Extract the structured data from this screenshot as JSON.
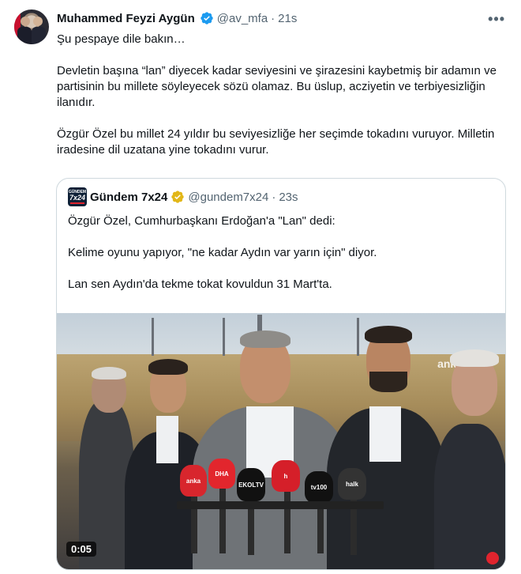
{
  "author": {
    "name": "Muhammed Feyzi Aygün",
    "handle": "@av_mfa",
    "separator": "·",
    "time": "21s",
    "more_label": "•••"
  },
  "tweet": {
    "lines": [
      "Şu pespaye dile bakın…",
      "",
      "Devletin başına “lan” diyecek kadar seviyesini ve şirazesini kaybetmiş bir adamın ve partisinin bu millete söyleyecek sözü olamaz. Bu üslup, acziyetin ve terbiyesizliğin ilanıdır.",
      "",
      "Özgür Özel bu millet 24 yıldır bu seviyesizliğe her seçimde tokadını vuruyor. Milletin iradesine dil uzatana yine tokadını vurur."
    ]
  },
  "quote": {
    "avatar_top": "GÜNDEM",
    "avatar_main": "7x24",
    "name": "Gündem 7x24",
    "handle": "@gundem7x24",
    "separator": "·",
    "time": "23s",
    "lines": [
      "Özgür Özel, Cumhurbaşkanı Erdoğan'a \"Lan\" dedi:",
      "",
      "Kelime oyunu yapıyor, \"ne kadar Aydın var yarın için\" diyor.",
      "",
      "Lan sen Aydın'da tekme tokat kovuldun 31 Mart'ta."
    ],
    "video": {
      "duration": "0:05",
      "watermark": "anka",
      "mic_labels": [
        "anka",
        "DHA",
        "EKOLTV",
        "h",
        "tv100",
        "halk"
      ]
    }
  },
  "colors": {
    "verified_blue": "#1d9bf0",
    "verified_gold": "#e2b719",
    "text": "#0f1419",
    "muted": "#536471",
    "border": "#cfd9de"
  }
}
